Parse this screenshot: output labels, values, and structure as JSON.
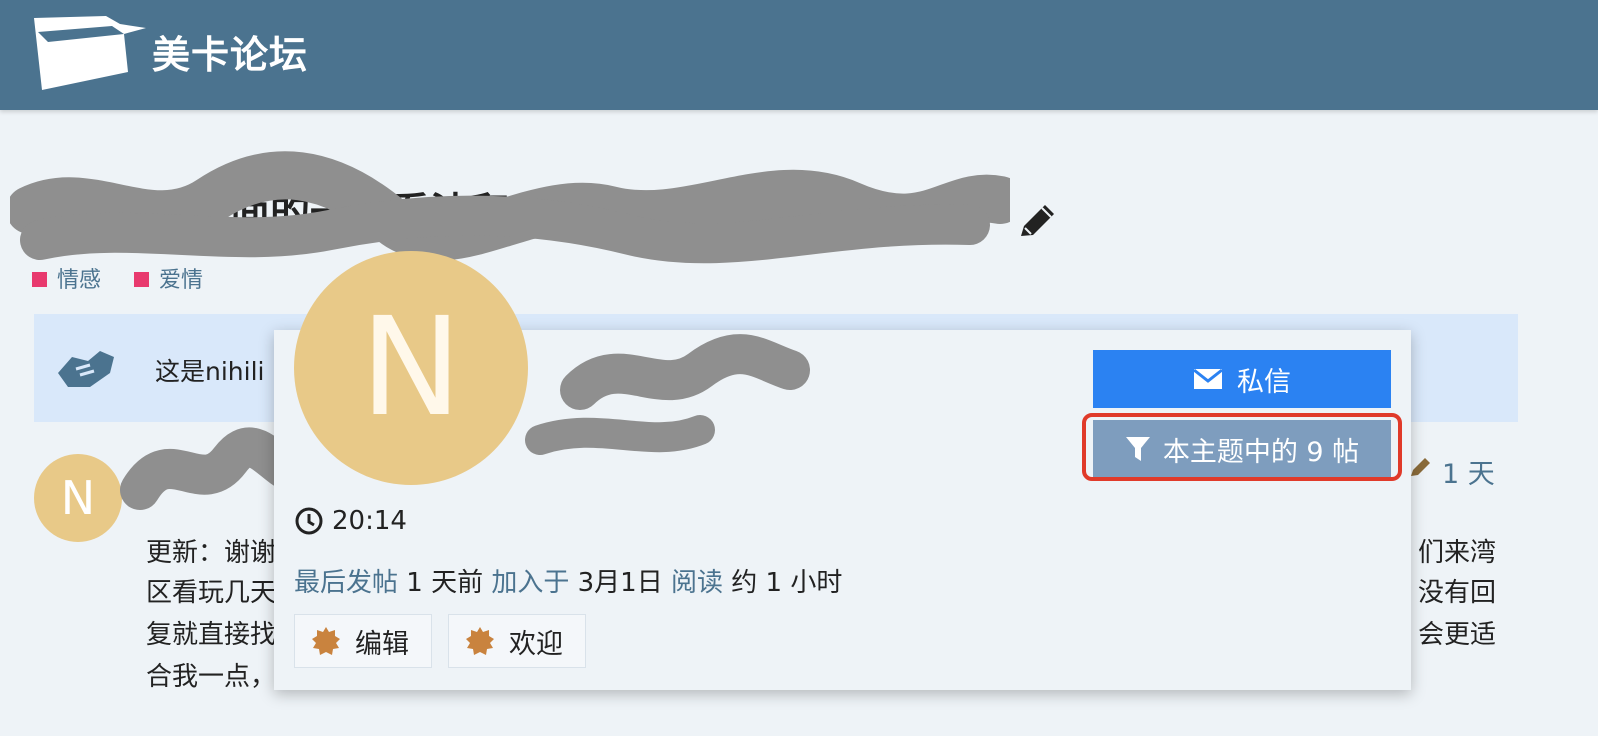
{
  "header": {
    "site_title": "美卡论坛"
  },
  "topic": {
    "title": "社会就业方面的一些看法和分享",
    "categories": [
      {
        "label": "情感",
        "color": "#e8396e"
      },
      {
        "label": "爱情",
        "color": "#e8396e"
      }
    ]
  },
  "banner": {
    "text": "这是nihili"
  },
  "post": {
    "avatar_letter": "N",
    "date": "1 天",
    "lines_left": [
      "更新：谢谢",
      "区看玩几天",
      "复就直接找",
      "合我一点，"
    ],
    "lines_right": [
      "们来湾",
      "没有回",
      "会更适"
    ]
  },
  "user_card": {
    "avatar_letter": "N",
    "message_button": "私信",
    "filter_button": "本主题中的 9 帖",
    "local_time": "20:14",
    "stats": {
      "last_post_label": "最后发帖",
      "last_post_value": "1 天前",
      "joined_label": "加入于",
      "joined_value": "3月1日",
      "read_label": "阅读",
      "read_value": "约 1 小时"
    },
    "badges": [
      "编辑",
      "欢迎"
    ]
  },
  "colors": {
    "header": "#4b738f",
    "accent": "#2b82f2",
    "highlight": "#e03a2a",
    "avatar": "#e8c988"
  }
}
